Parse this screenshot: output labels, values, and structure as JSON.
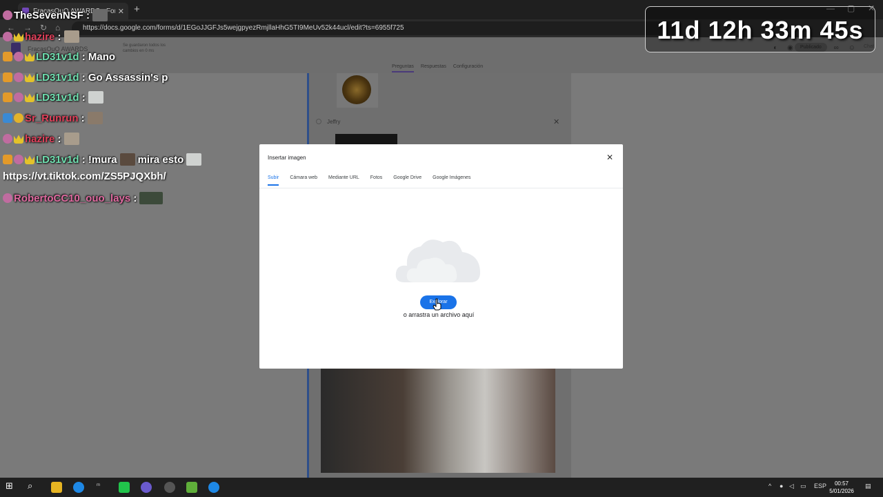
{
  "browser": {
    "tab_title": "FracasOuO AWARDS - Formulario",
    "url": "https://docs.google.com/forms/d/1EGoJJGFJs5wejgpyezRmjllaHhG5TI9MeUv52k44ucl/edit?ts=6955f725"
  },
  "forms": {
    "title": "FracasOuO AWARDS",
    "saved_note": "Se guardaron todos los cambios en 0 ms",
    "tabs": [
      "Preguntas",
      "Respuestas",
      "Configuración"
    ],
    "active_tab": "Preguntas",
    "publish_label": "Publicado",
    "chat_label": "Chat",
    "option_label": "Jeffry"
  },
  "modal": {
    "title": "Insertar imagen",
    "tabs": [
      "Subir",
      "Cámara web",
      "Mediante URL",
      "Fotos",
      "Google Drive",
      "Google Imágenes"
    ],
    "active_tab": "Subir",
    "browse_label": "Explorar",
    "drag_text": "o arrastra un archivo aquí",
    "accent_color": "#1a73e8"
  },
  "chat": {
    "header_user": "TheSevenNSF",
    "messages": [
      {
        "user": "hazire",
        "text": ""
      },
      {
        "user": "LD31v1d",
        "text": "Mano"
      },
      {
        "user": "LD31v1d",
        "text": "Go Assassin's p"
      },
      {
        "user": "LD31v1d",
        "text": ""
      },
      {
        "user": "Sr_Runrun",
        "text": ""
      },
      {
        "user": "hazire",
        "text": ""
      },
      {
        "user": "LD31v1d",
        "text": "!mura",
        "text2": "mira esto"
      },
      {
        "user": "RobertoCC10_ouo_lays",
        "text": ""
      }
    ],
    "link_text": "https://vt.tiktok.com/ZS5PJQXbh/"
  },
  "timer": {
    "text": "11d 12h 33m 45s"
  },
  "taskbar": {
    "language": "ESP",
    "time": "00:57",
    "date": "5/01/2026"
  }
}
